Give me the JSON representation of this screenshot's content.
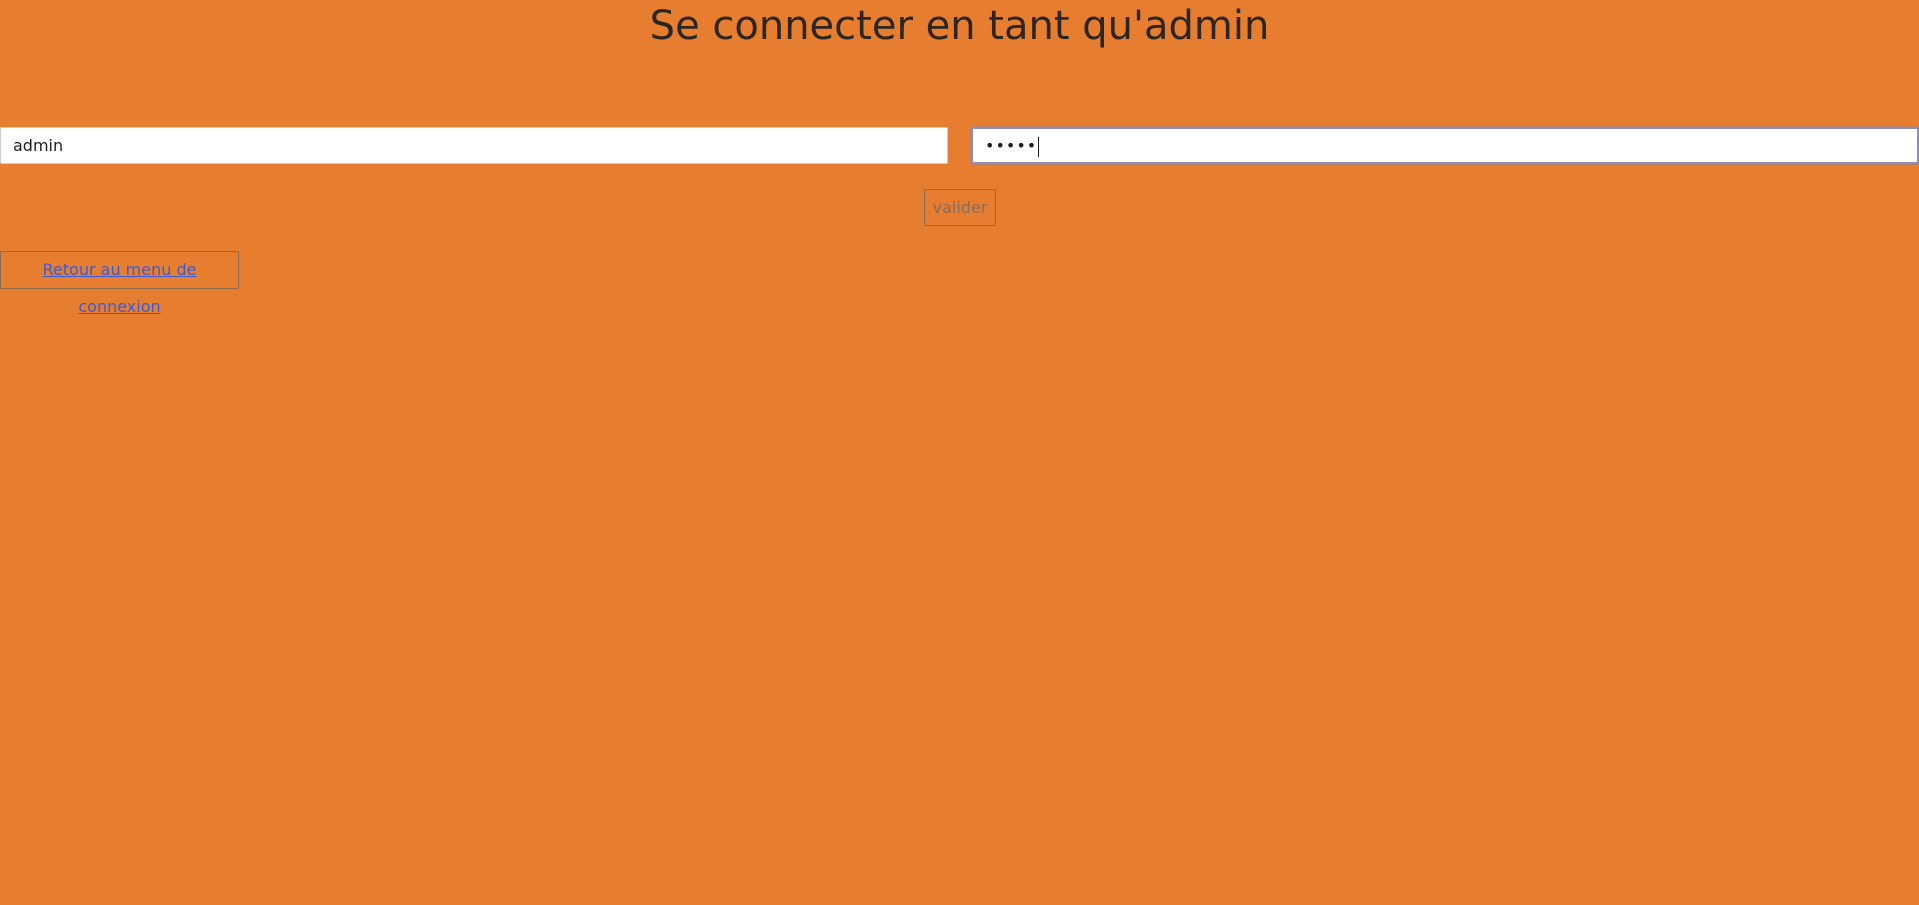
{
  "page": {
    "title": "Se connecter en tant qu'admin",
    "background_color": "#e77e2f"
  },
  "form": {
    "username_value": "admin",
    "password_masked": "•••••",
    "submit_label": "valider"
  },
  "links": {
    "back_label": "Retour au menu de connexion",
    "link_color": "#3d5bd6"
  }
}
